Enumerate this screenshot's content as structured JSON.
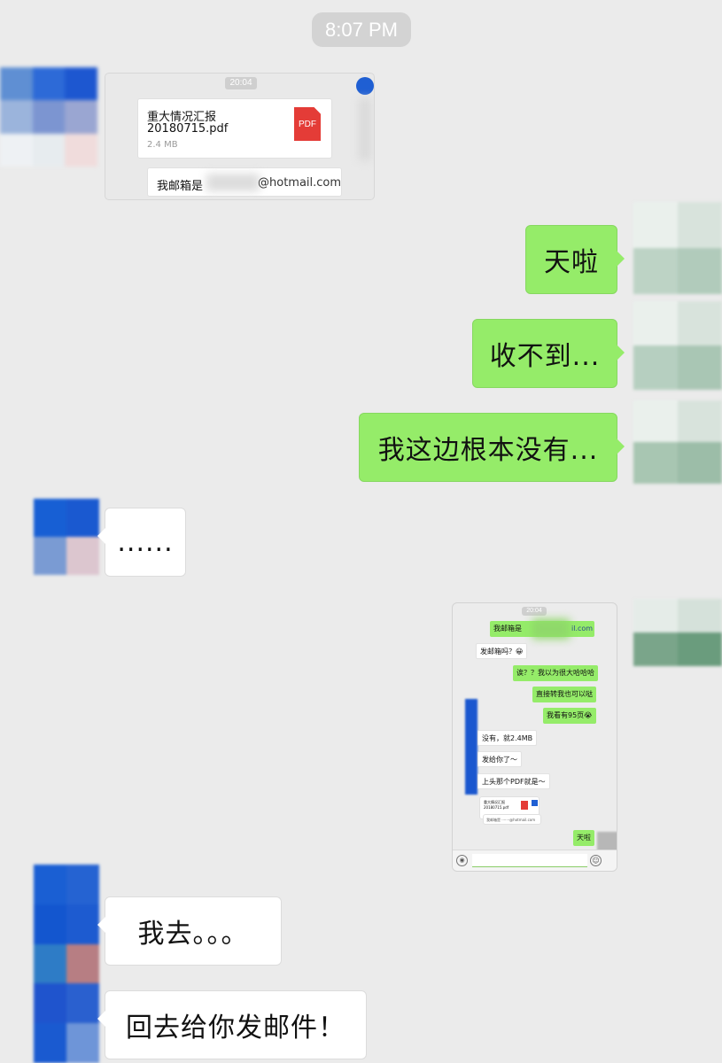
{
  "header": {
    "time": "8:07 PM"
  },
  "messages": {
    "m1": {
      "time": "20:04",
      "file_title_line1": "重大情况汇报",
      "file_title_line2": "20180715.pdf",
      "file_size": "2.4 MB",
      "file_badge": "PDF",
      "email_prefix": "我邮箱是",
      "email_suffix": "@hotmail.com"
    },
    "m2": {
      "text": "天啦"
    },
    "m3": {
      "text": "收不到..."
    },
    "m4": {
      "text": "我这边根本没有..."
    },
    "m5": {
      "text": "......"
    },
    "m6": {
      "time": "20:04",
      "lines": {
        "email": "我邮箱是",
        "email_tail": "il.com",
        "ask": "发邮箱吗？😀",
        "huh": "诶？？我以为很大哈哈哈",
        "transfer": "直接转我也可以哒",
        "pages": "我看有95页😭",
        "size": "没有，就2.4MB",
        "sent": "发给你了～",
        "above": "上头那个PDF就是～",
        "tianla": "天啦"
      },
      "file_title_line1": "重大情况汇报",
      "file_title_line2": "20180715.pdf",
      "email_full": "我邮箱是 ·······@hotmail.com"
    },
    "m7": {
      "text": "我去。。。"
    },
    "m8": {
      "text": "回去给你发邮件！"
    }
  },
  "colors": {
    "background": "#ebebeb",
    "sent_bubble": "#95ec69",
    "received_bubble": "#ffffff",
    "pdf_red": "#e43c37"
  },
  "icons": [
    "pdf-icon",
    "voice-icon",
    "emoji-icon"
  ]
}
